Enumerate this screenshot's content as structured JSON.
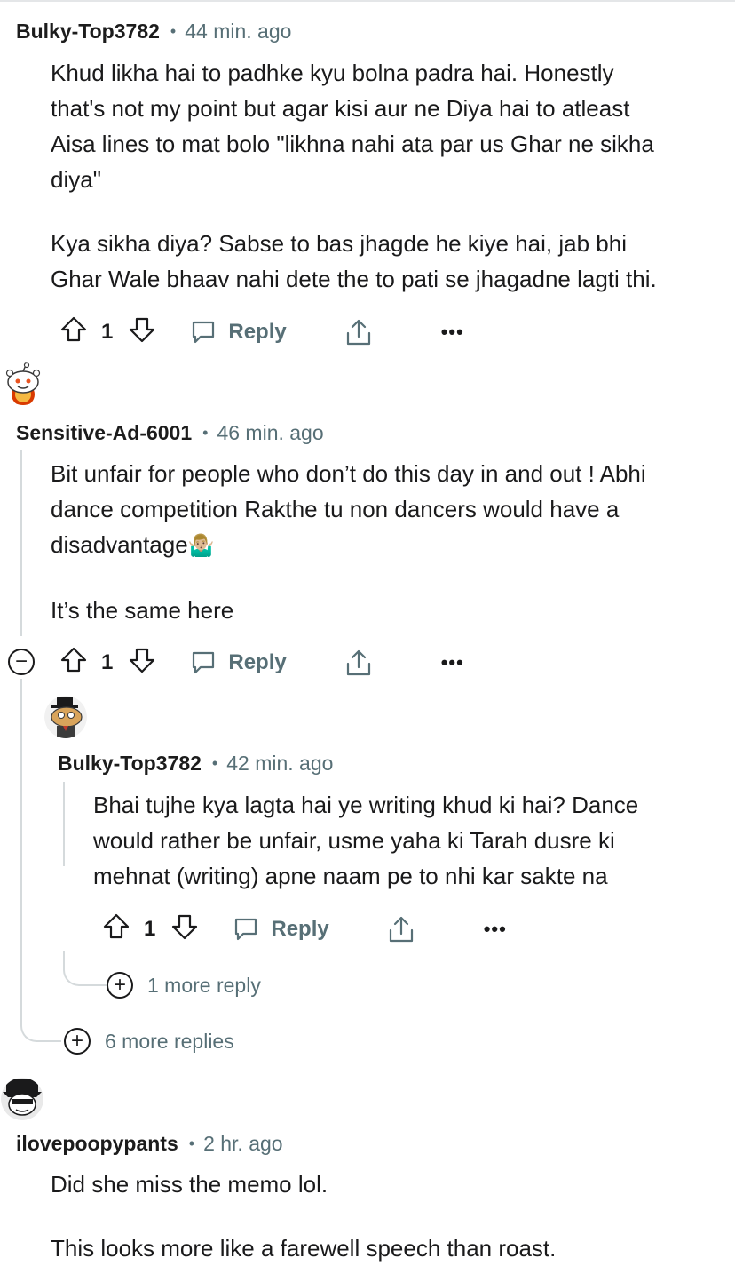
{
  "comments": [
    {
      "username": "Bulky-Top3782",
      "time": "44 min. ago",
      "lines": [
        "Khud likha hai to padhke kyu bolna padra hai. Honestly",
        "that's not my point but agar kisi aur ne Diya hai to atleast",
        "Aisa lines to mat bolo \"likhna nahi ata par us Ghar ne sikha",
        "diya\"",
        "Kya sikha diya? Sabse to bas jhagde he kiye hai, jab bhi",
        "Ghar Wale bhaav nahi dete the to pati se jhagadne lagti thi."
      ],
      "votes": "1",
      "reply_label": "Reply"
    },
    {
      "username": "Sensitive-Ad-6001",
      "time": "46 min. ago",
      "lines": [
        "Bit unfair for people who don’t do this day in and out ! Abhi",
        "dance competition Rakthe tu non dancers would have a",
        "disadvantage",
        "It’s the same here"
      ],
      "emoji": "🤷🏼‍♂️",
      "votes": "1",
      "reply_label": "Reply",
      "collapse_symbol": "−"
    },
    {
      "username": "Bulky-Top3782",
      "time": "42 min. ago",
      "lines": [
        "Bhai tujhe kya lagta hai ye writing khud ki hai? Dance",
        "would rather be unfair, usme yaha ki Tarah dusre ki",
        "mehnat (writing) apne naam pe to nhi kar sakte na"
      ],
      "votes": "1",
      "reply_label": "Reply",
      "more_replies": "1 more reply"
    },
    {
      "username": "ilovepoopypants",
      "time": "2 hr. ago",
      "lines": [
        "Did she miss the memo lol.",
        "This looks more like a farewell speech than roast."
      ]
    }
  ],
  "thread_more_replies": "6 more replies",
  "more_icon": "•••",
  "separator": "•",
  "plus_symbol": "+",
  "colors": {
    "meta": "#576f76",
    "thread_line": "#d5dadc",
    "text": "#1a1a1b"
  }
}
